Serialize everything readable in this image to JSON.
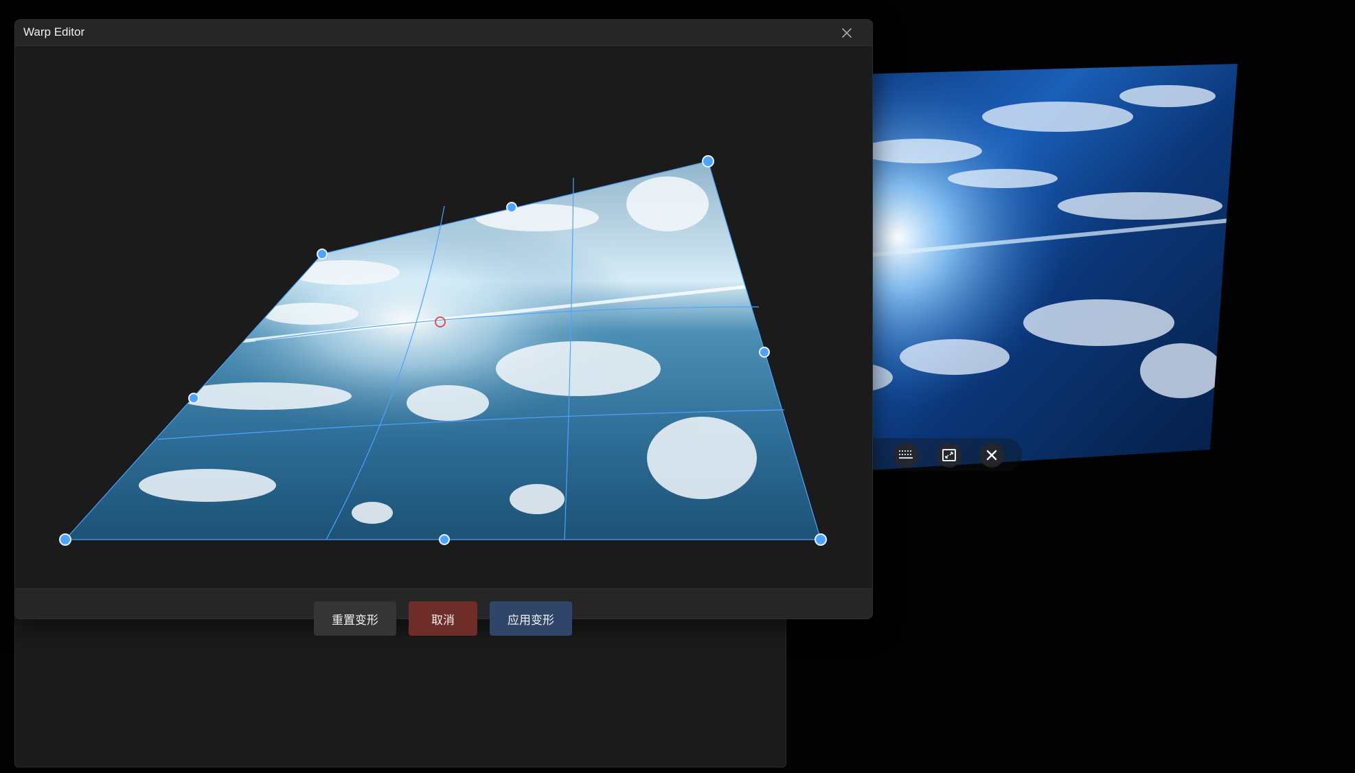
{
  "dialog": {
    "title": "Warp Editor",
    "close_icon": "close-icon"
  },
  "footer": {
    "reset_label": "重置变形",
    "cancel_label": "取消",
    "apply_label": "应用变形"
  },
  "layer_toolbar": {
    "icons": [
      "grid-icon",
      "fit-frame-icon",
      "close-icon"
    ]
  },
  "colors": {
    "accent": "#4da3ff",
    "center_marker": "#e05050",
    "cancel": "#6e2d28",
    "apply": "#2f4669"
  }
}
